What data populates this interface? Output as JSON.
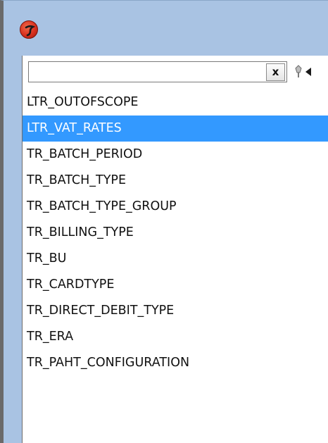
{
  "search": {
    "value": "",
    "placeholder": "",
    "clear_label": "x"
  },
  "list": {
    "selected_index": 1,
    "items": [
      {
        "label": "LTR_OUTOFSCOPE"
      },
      {
        "label": "LTR_VAT_RATES"
      },
      {
        "label": "TR_BATCH_PERIOD"
      },
      {
        "label": "TR_BATCH_TYPE"
      },
      {
        "label": "TR_BATCH_TYPE_GROUP"
      },
      {
        "label": "TR_BILLING_TYPE"
      },
      {
        "label": "TR_BU"
      },
      {
        "label": "TR_CARDTYPE"
      },
      {
        "label": "TR_DIRECT_DEBIT_TYPE"
      },
      {
        "label": "TR_ERA"
      },
      {
        "label": "TR_PAHT_CONFIGURATION"
      }
    ]
  },
  "colors": {
    "selection": "#3399ff",
    "title_bar": "#a9c3e3"
  },
  "icons": {
    "app": "app-logo-icon",
    "nav": "pin-arrow-left-icon"
  }
}
